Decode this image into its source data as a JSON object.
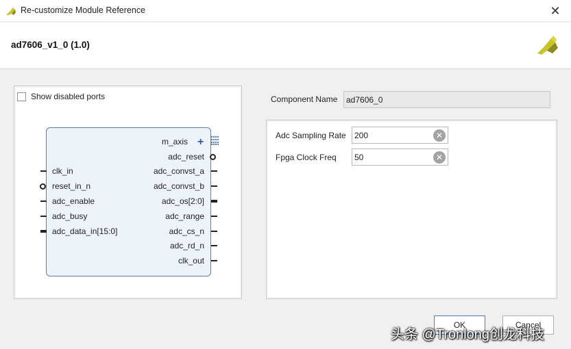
{
  "window": {
    "title": "Re-customize Module Reference",
    "close_glyph": "✕"
  },
  "header": {
    "title": "ad7606_v1_0 (1.0)"
  },
  "symbol": {
    "show_disabled_ports_label": "Show disabled ports",
    "show_disabled_ports_checked": false,
    "left_ports": [
      "clk_in",
      "reset_in_n",
      "adc_enable",
      "adc_busy",
      "adc_data_in[15:0]"
    ],
    "right_ports": [
      "m_axis",
      "adc_reset",
      "adc_convst_a",
      "adc_convst_b",
      "adc_os[2:0]",
      "adc_range",
      "adc_cs_n",
      "adc_rd_n",
      "clk_out"
    ],
    "plus_glyph": "+"
  },
  "component": {
    "label": "Component Name",
    "value": "ad7606_0"
  },
  "params": [
    {
      "label": "Adc Sampling Rate",
      "value": "200"
    },
    {
      "label": "Fpga Clock Freq",
      "value": "50"
    }
  ],
  "clear_glyph": "✕",
  "buttons": {
    "ok": "OK",
    "cancel": "Cancel"
  },
  "watermark": "头条 @Tronlong创龙科技",
  "colors": {
    "accent": "#4a7fc0",
    "block_fill": "#eef3fa",
    "block_border": "#5a7db8",
    "logo_yellow": "#c8c42a",
    "logo_dark": "#8a8a1e"
  }
}
